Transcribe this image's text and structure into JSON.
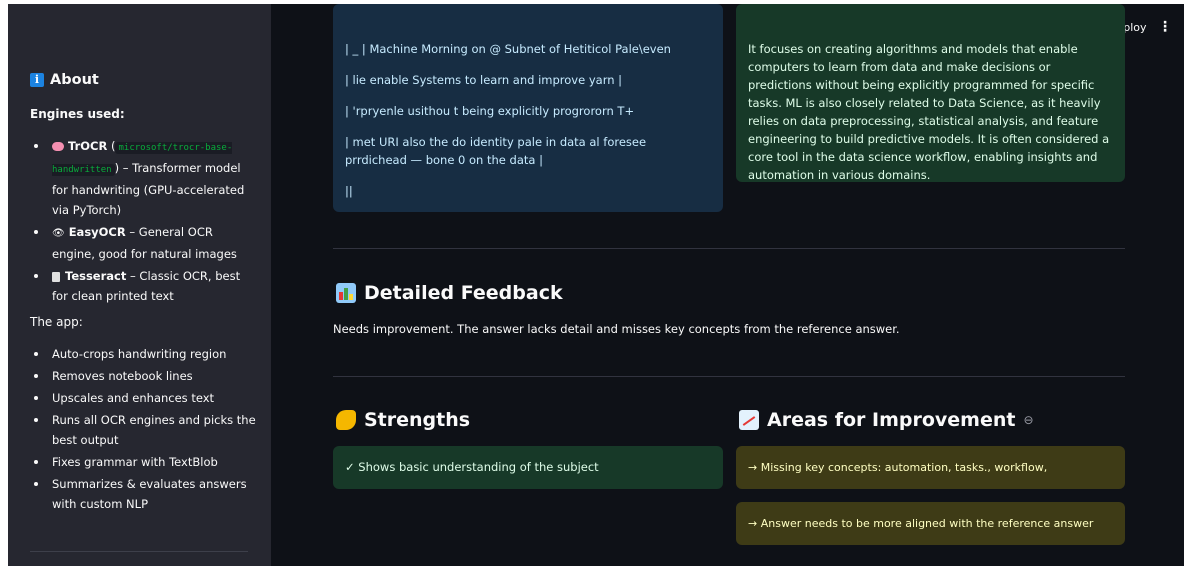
{
  "header": {
    "deploy_label": "Deploy",
    "menu_icon": "kebab-menu-icon"
  },
  "sidebar": {
    "about_title": "About",
    "engines_label": "Engines used:",
    "engines": [
      {
        "name": "TrOCR",
        "code": "microsoft/trocr-base-handwritten",
        "desc_before": "(",
        "desc": ") – Transformer model for handwriting (GPU-accelerated via PyTorch)"
      },
      {
        "name": "EasyOCR",
        "desc": " – General OCR engine, good for natural images"
      },
      {
        "name": "Tesseract",
        "desc": " – Classic OCR, best for clean printed text"
      }
    ],
    "app_label": "The app:",
    "app_items": [
      "Auto-crops handwriting region",
      "Removes notebook lines",
      "Upscales and enhances text",
      "Runs all OCR engines and picks the best output",
      "Fixes grammar with TextBlob",
      "Summarizes & evaluates answers with custom NLP"
    ]
  },
  "extracted_box": {
    "lines": [
      "| _ | Machine Morning on @ Subnet of Hetiticol Pale\\even",
      "| lie enable Systems to learn and improve yarn |",
      "| 'rpryenle usithou t being explicitly progrororn T+",
      "| met URI also the do identity pale in data al foresee prrdichead — bone 0 on the data |",
      "||"
    ]
  },
  "reference_box": {
    "text": "It focuses on creating algorithms and models that enable computers to learn from data and make decisions or predictions without being explicitly programmed for specific tasks. ML is also closely related to Data Science, as it heavily relies on data preprocessing, statistical analysis, and feature engineering to build predictive models. It is often considered a core tool in the data science workflow, enabling insights and automation in various domains."
  },
  "feedback": {
    "title": "Detailed Feedback",
    "text": "Needs improvement. The answer lacks detail and misses key concepts from the reference answer."
  },
  "strengths": {
    "title": "Strengths",
    "items": [
      "✓ Shows basic understanding of the subject"
    ]
  },
  "improvements": {
    "title": "Areas for Improvement",
    "items": [
      "→ Missing key concepts: automation, tasks., workflow,",
      "→ Answer needs to be more aligned with the reference answer"
    ]
  },
  "colors": {
    "background": "#0e1117",
    "sidebar": "#262730",
    "info_box": "#172d43",
    "success_box": "#173928",
    "warning_box": "#3e3b16"
  }
}
